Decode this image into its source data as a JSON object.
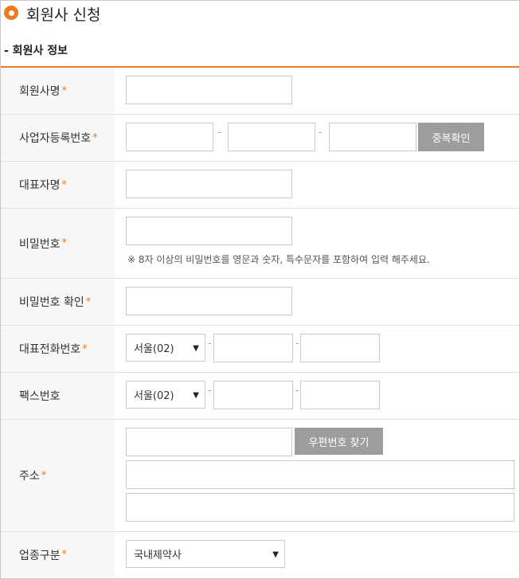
{
  "page": {
    "title": "회원사 신청",
    "section_title": "- 회원사 정보",
    "accent_color": "#ee7a22",
    "required_mark": "*"
  },
  "form": {
    "company_name": {
      "label": "회원사명",
      "value": ""
    },
    "business_reg": {
      "label": "사업자등록번호",
      "sep1": "-",
      "sep2": "-",
      "check_button": "중복확인"
    },
    "ceo_name": {
      "label": "대표자명",
      "value": ""
    },
    "password": {
      "label": "비밀번호",
      "note": "※ 8자 이상의 비밀번호를 영문과 숫자, 특수문자를 포함하여 입력 해주세요."
    },
    "password_confirm": {
      "label": "비밀번호 확인"
    },
    "phone": {
      "label": "대표전화번호",
      "area_selected": "서울(02)",
      "sep1": "-",
      "sep2": "-"
    },
    "fax": {
      "label": "팩스번호",
      "area_selected": "서울(02)",
      "sep1": "-",
      "sep2": "-"
    },
    "address": {
      "label": "주소",
      "zip_button": "우편번호 찾기"
    },
    "business_type": {
      "label": "업종구분",
      "selected": "국내제약사"
    }
  }
}
